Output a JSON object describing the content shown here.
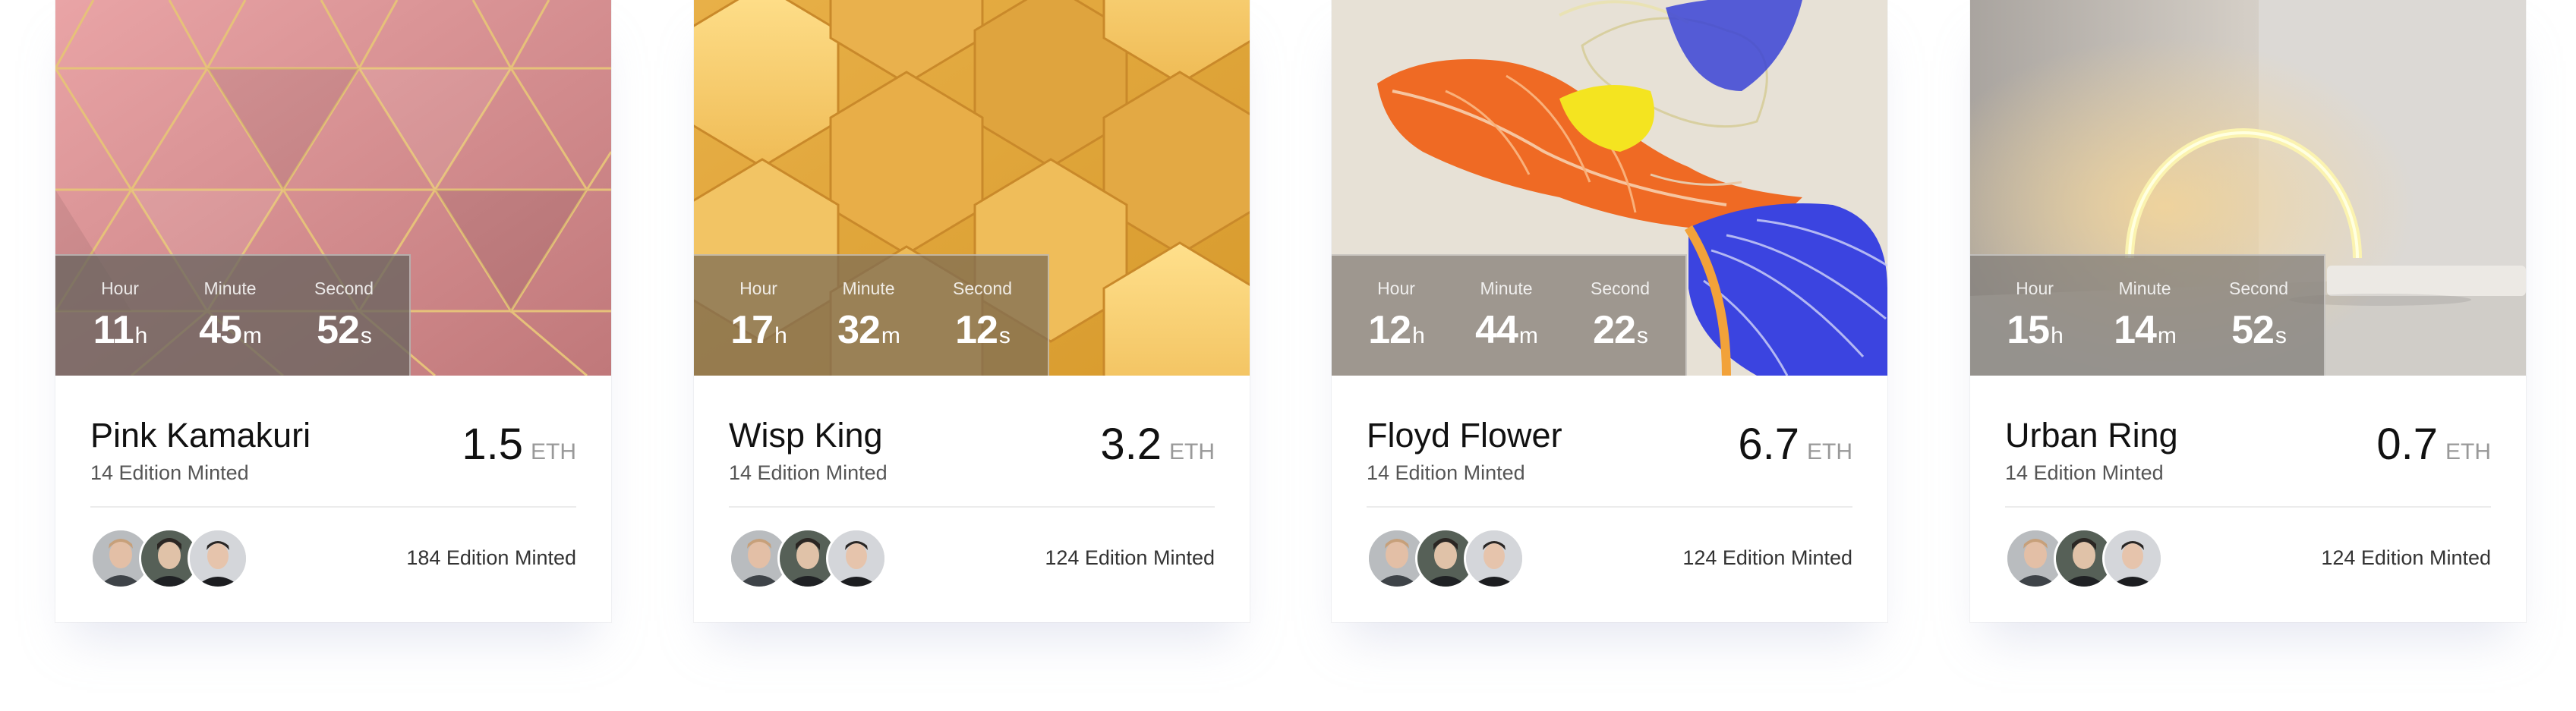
{
  "cards": [
    {
      "name": "Pink Kamakuri",
      "subtitle": "14 Edition Minted",
      "price": "1.5",
      "currency": "ETH",
      "minted": "184 Edition Minted",
      "image": "pink-triangle-pattern",
      "timer": {
        "hour_label": "Hour",
        "hour": "11",
        "hour_suffix": "h",
        "minute_label": "Minute",
        "minute": "45",
        "minute_suffix": "m",
        "second_label": "Second",
        "second": "52",
        "second_suffix": "s"
      }
    },
    {
      "name": "Wisp King",
      "subtitle": "14 Edition Minted",
      "price": "3.2",
      "currency": "ETH",
      "minted": "124 Edition Minted",
      "image": "yellow-hexagon-pattern",
      "timer": {
        "hour_label": "Hour",
        "hour": "17",
        "hour_suffix": "h",
        "minute_label": "Minute",
        "minute": "32",
        "minute_suffix": "m",
        "second_label": "Second",
        "second": "12",
        "second_suffix": "s"
      }
    },
    {
      "name": "Floyd Flower",
      "subtitle": "14 Edition Minted",
      "price": "6.7",
      "currency": "ETH",
      "minted": "124 Edition Minted",
      "image": "colorful-leaves-art",
      "timer": {
        "hour_label": "Hour",
        "hour": "12",
        "hour_suffix": "h",
        "minute_label": "Minute",
        "minute": "44",
        "minute_suffix": "m",
        "second_label": "Second",
        "second": "22",
        "second_suffix": "s"
      }
    },
    {
      "name": "Urban Ring",
      "subtitle": "14 Edition Minted",
      "price": "0.7",
      "currency": "ETH",
      "minted": "124 Edition Minted",
      "image": "glowing-ring-room",
      "timer": {
        "hour_label": "Hour",
        "hour": "15",
        "hour_suffix": "h",
        "minute_label": "Minute",
        "minute": "14",
        "minute_suffix": "m",
        "second_label": "Second",
        "second": "52",
        "second_suffix": "s"
      }
    }
  ],
  "avatar_icons": [
    "user-avatar-1",
    "user-avatar-2",
    "user-avatar-3"
  ],
  "colors": {
    "text_primary": "#111111",
    "text_muted": "#999999",
    "timer_overlay": "#69645f"
  }
}
